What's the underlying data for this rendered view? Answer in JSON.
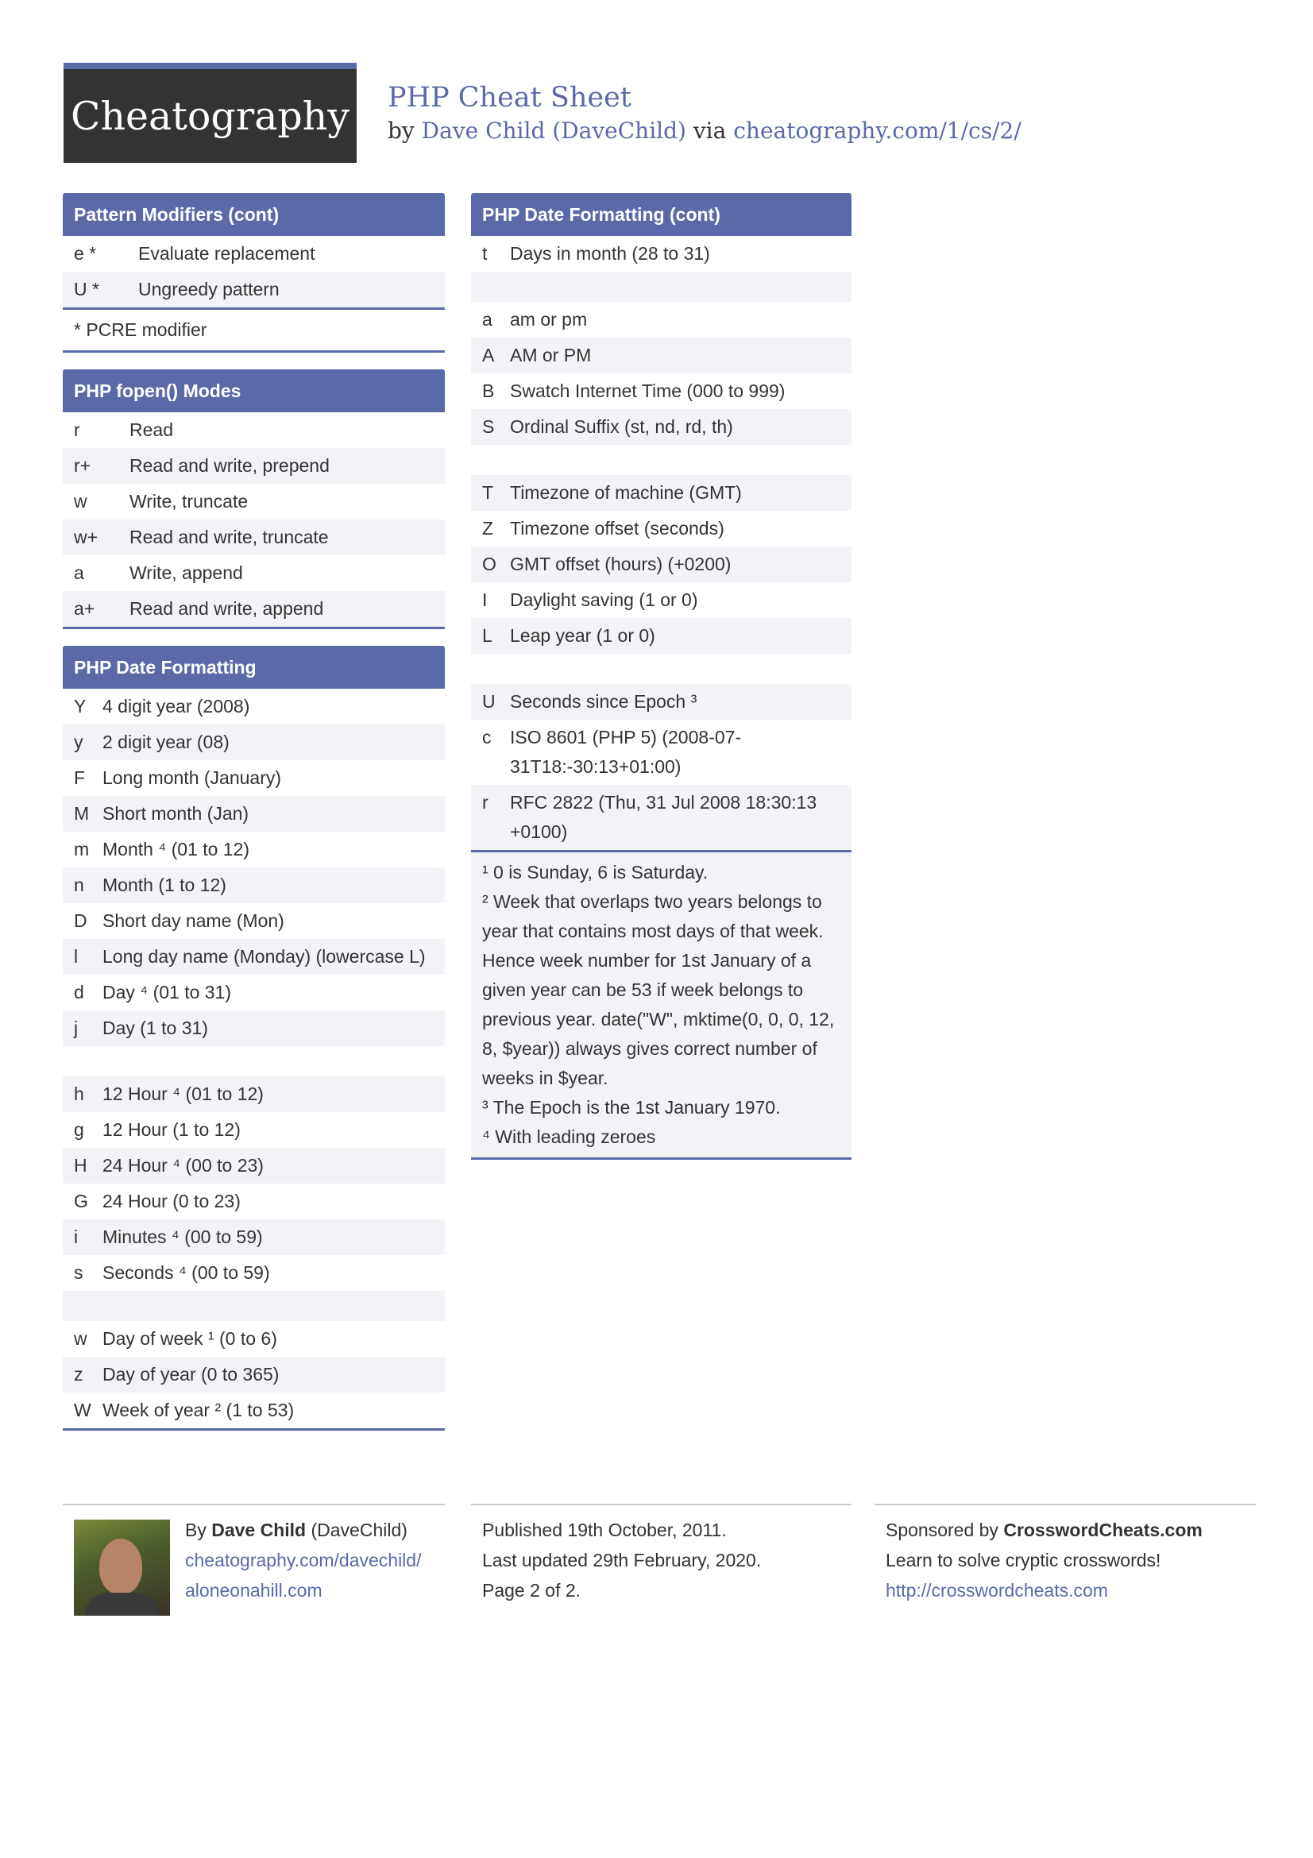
{
  "header": {
    "logo": "Cheatography",
    "title": "PHP Cheat Sheet",
    "by_prefix": "by",
    "author": "Dave Child (DaveChild)",
    "via": "via",
    "url": "cheatography.com/1/cs/2/"
  },
  "pattern_modifiers": {
    "title": "Pattern Modifiers (cont)",
    "rows": [
      {
        "k": "e *",
        "v": "Evaluate replacement"
      },
      {
        "k": "U *",
        "v": "Ungreedy pattern"
      }
    ],
    "note": "* PCRE modifier"
  },
  "fopen_modes": {
    "title": "PHP fopen() Modes",
    "rows": [
      {
        "k": "r",
        "v": "Read"
      },
      {
        "k": "r+",
        "v": "Read and write, prepend"
      },
      {
        "k": "w",
        "v": "Write, truncate"
      },
      {
        "k": "w+",
        "v": "Read and write, truncate"
      },
      {
        "k": "a",
        "v": "Write, append"
      },
      {
        "k": "a+",
        "v": "Read and write, append"
      }
    ]
  },
  "date_formatting": {
    "title": "PHP Date Formatting",
    "rows": [
      {
        "k": "Y",
        "v": "4 digit year (2008)"
      },
      {
        "k": "y",
        "v": "2 digit year (08)"
      },
      {
        "k": "F",
        "v": "Long month (January)"
      },
      {
        "k": "M",
        "v": "Short month (Jan)"
      },
      {
        "k": "m",
        "v": "Month ⁴ (01 to 12)"
      },
      {
        "k": "n",
        "v": "Month (1 to 12)"
      },
      {
        "k": "D",
        "v": "Short day name (Mon)"
      },
      {
        "k": "l",
        "v": "Long day name (Monday) (lowercase L)"
      },
      {
        "k": "d",
        "v": "Day ⁴ (01 to 31)"
      },
      {
        "k": "j",
        "v": "Day (1 to 31)"
      },
      {
        "k": "",
        "v": ""
      },
      {
        "k": "h",
        "v": "12 Hour ⁴ (01 to 12)"
      },
      {
        "k": "g",
        "v": "12 Hour (1 to 12)"
      },
      {
        "k": "H",
        "v": "24 Hour ⁴ (00 to 23)"
      },
      {
        "k": "G",
        "v": "24 Hour (0 to 23)"
      },
      {
        "k": "i",
        "v": "Minutes ⁴ (00 to 59)"
      },
      {
        "k": "s",
        "v": "Seconds ⁴ (00 to 59)"
      },
      {
        "k": "",
        "v": ""
      },
      {
        "k": "w",
        "v": "Day of week ¹ (0 to 6)"
      },
      {
        "k": "z",
        "v": "Day of year (0 to 365)"
      },
      {
        "k": "W",
        "v": "Week of year ² (1 to 53)"
      }
    ]
  },
  "date_formatting_cont": {
    "title": "PHP Date Formatting (cont)",
    "rows": [
      {
        "k": "t",
        "v": "Days in month (28 to 31)"
      },
      {
        "k": "",
        "v": ""
      },
      {
        "k": "a",
        "v": "am or pm"
      },
      {
        "k": "A",
        "v": "AM or PM"
      },
      {
        "k": "B",
        "v": "Swatch Internet Time (000 to 999)"
      },
      {
        "k": "S",
        "v": "Ordinal Suffix (st, nd, rd, th)"
      },
      {
        "k": "",
        "v": ""
      },
      {
        "k": "T",
        "v": "Timezone of machine (GMT)"
      },
      {
        "k": "Z",
        "v": "Timezone offset (seconds)"
      },
      {
        "k": "O",
        "v": "GMT offset (hours) (+0200)"
      },
      {
        "k": "I",
        "v": "Daylight saving (1 or 0)"
      },
      {
        "k": "L",
        "v": "Leap year (1 or 0)"
      },
      {
        "k": "",
        "v": ""
      },
      {
        "k": "U",
        "v": "Seconds since Epoch ³"
      },
      {
        "k": "c",
        "v": "ISO 8601 (PHP 5) (2008-07-31T18:-30:13+01:00)"
      },
      {
        "k": "r",
        "v": "RFC 2822 (Thu, 31 Jul 2008 18:30:13 +0100)"
      }
    ],
    "notes": [
      "¹ 0 is Sunday, 6 is Saturday.",
      "² Week that overlaps two years belongs to year that contains most days of that week. Hence week number for 1st January of a given year can be 53 if week belongs to previous year. date(\"W\", mktime(0, 0, 0, 12, 8, $year)) always gives correct number of weeks in $year.",
      "³ The Epoch is the 1st January 1970.",
      "⁴ With leading zeroes"
    ]
  },
  "footer": {
    "author_by": "By",
    "author_name": "Dave Child",
    "author_handle": "(DaveChild)",
    "author_link1": "cheatography.com/davechild/",
    "author_link2": "aloneonahill.com",
    "published": "Published 19th October, 2011.",
    "updated": "Last updated 29th February, 2020.",
    "page": "Page 2 of 2.",
    "sponsored_by": "Sponsored by",
    "sponsor_name": "CrosswordCheats.com",
    "sponsor_tagline": "Learn to solve cryptic crosswords!",
    "sponsor_url": "http://crosswordcheats.com"
  },
  "colors": {
    "accent": "#5a6aa8",
    "logo_bg": "#333333",
    "row_alt": "#f2f3f7"
  }
}
